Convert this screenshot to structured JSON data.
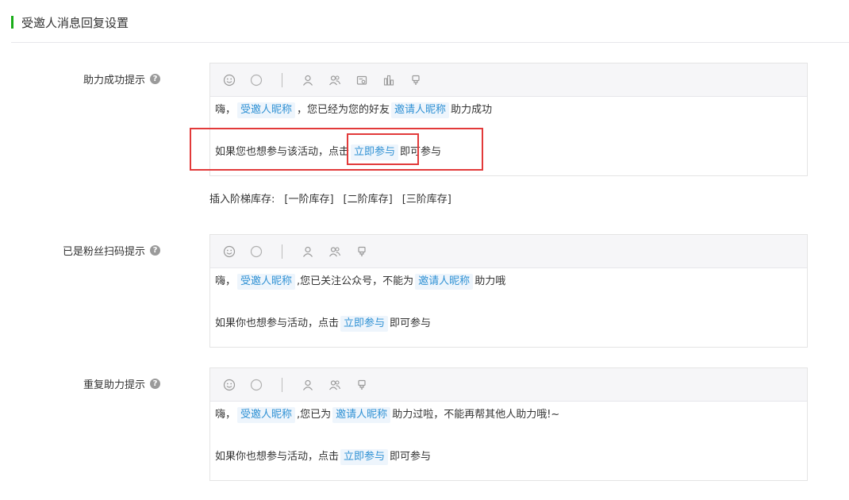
{
  "section": {
    "title": "受邀人消息回复设置"
  },
  "help_glyph": "?",
  "fields": [
    {
      "label": "助力成功提示",
      "line1": {
        "prefix": "嗨，",
        "tag1": "受邀人昵称",
        "mid": "，您已经为您的好友",
        "tag2": "邀请人昵称",
        "suffix": "助力成功"
      },
      "line2": {
        "prefix": "如果您也想参与该活动，点击",
        "tag": "立即参与",
        "suffix": "即可参与"
      }
    },
    {
      "label": "已是粉丝扫码提示",
      "line1": {
        "prefix": "嗨，",
        "tag1": "受邀人昵称",
        "mid": ",您已关注公众号，不能为",
        "tag2": "邀请人昵称",
        "suffix": "助力哦"
      },
      "line2": {
        "prefix": "如果你也想参与活动，点击",
        "tag": "立即参与",
        "suffix": "即可参与"
      }
    },
    {
      "label": "重复助力提示",
      "line1": {
        "prefix": "嗨，",
        "tag1": "受邀人昵称",
        "mid": ",您已为",
        "tag2": "邀请人昵称",
        "suffix": "助力过啦，不能再帮其他人助力哦!~"
      },
      "line2": {
        "prefix": "如果你也想参与活动，点击",
        "tag": "立即参与",
        "suffix": "即可参与"
      }
    }
  ],
  "stock": {
    "label": "插入阶梯库存:",
    "links": [
      "[一阶库存]",
      "[二阶库存]",
      "[三阶库存]"
    ]
  },
  "icons": {
    "toolbar_full": [
      "emoji-icon",
      "compass-icon",
      "person-icon",
      "people-icon",
      "card-icon",
      "chart-icon",
      "stamp-icon"
    ],
    "toolbar_short": [
      "emoji-icon",
      "compass-icon",
      "person-icon",
      "people-icon",
      "stamp-icon"
    ]
  },
  "colors": {
    "accent": "#1aad19",
    "tag_text": "#2f91d4",
    "tag_bg": "#eef5fc",
    "highlight": "#e23a3a"
  }
}
